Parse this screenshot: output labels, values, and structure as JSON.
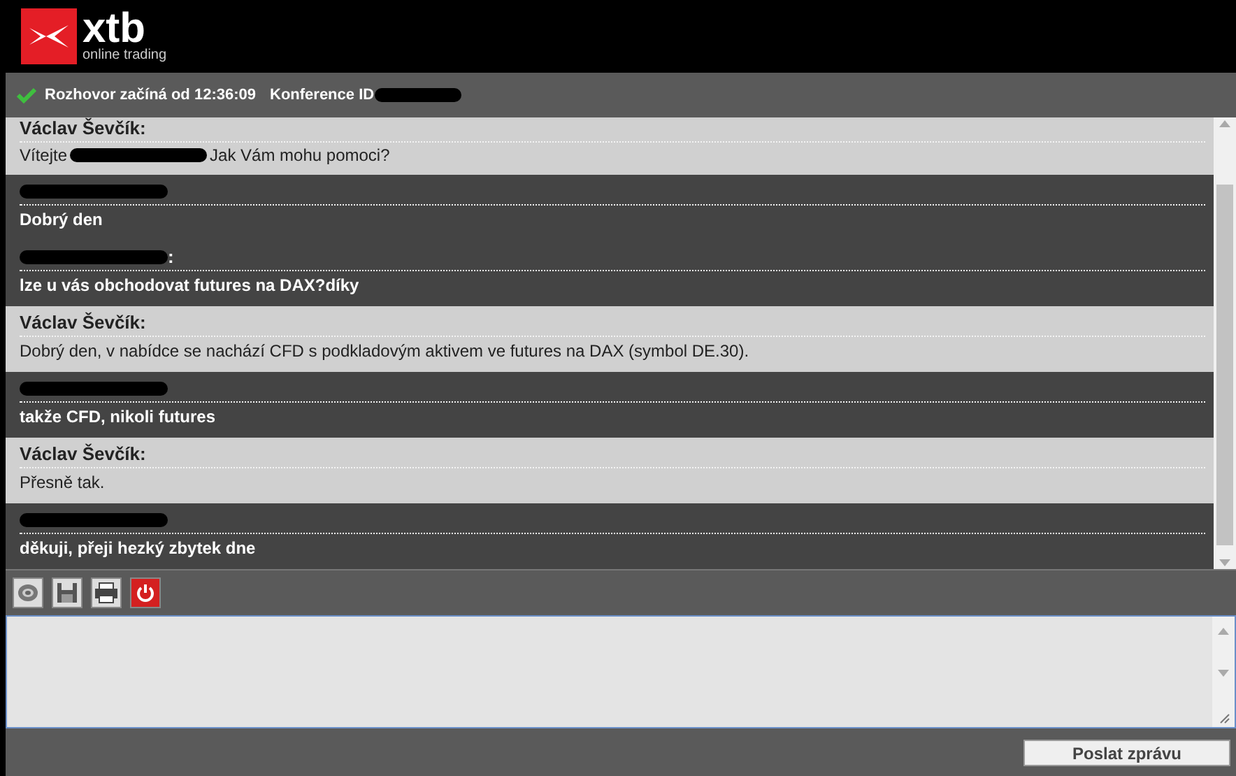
{
  "logo": {
    "name": "xtb",
    "tagline": "online trading"
  },
  "status": {
    "connected": true,
    "text": "Rozhovor začíná od 12:36:09",
    "conference_label": "Konference ID",
    "conference_redacted": true
  },
  "messages": [
    {
      "kind": "agent",
      "sender": "Václav Ševčík:",
      "text_parts": [
        "Vítejte",
        "Jak Vám mohu pomoci?"
      ],
      "redacted_in_text": true
    },
    {
      "kind": "client",
      "sender_redacted": true,
      "text_parts": [
        "Dobrý den"
      ],
      "redacted_in_text": false
    },
    {
      "kind": "client",
      "sender_redacted": true,
      "sender_suffix": ":",
      "text_parts": [
        "lze u vás obchodovat futures na DAX?díky"
      ],
      "redacted_in_text": false
    },
    {
      "kind": "agent",
      "sender": "Václav Ševčík:",
      "text_parts": [
        "Dobrý den, v nabídce se nachází CFD s podkladovým aktivem ve futures na DAX (symbol DE.30)."
      ],
      "redacted_in_text": false
    },
    {
      "kind": "client",
      "sender_redacted": true,
      "text_parts": [
        "takže CFD, nikoli futures"
      ],
      "redacted_in_text": false
    },
    {
      "kind": "agent",
      "sender": "Václav Ševčík:",
      "text_parts": [
        "Přesně tak."
      ],
      "redacted_in_text": false
    },
    {
      "kind": "client",
      "sender_redacted": true,
      "text_parts": [
        "děkuji, přeji hezký zbytek dne"
      ],
      "redacted_in_text": false
    }
  ],
  "toolbar": [
    {
      "kind": "sound"
    },
    {
      "kind": "save"
    },
    {
      "kind": "print"
    },
    {
      "kind": "exit"
    }
  ],
  "send_button": "Poslat zprávu"
}
